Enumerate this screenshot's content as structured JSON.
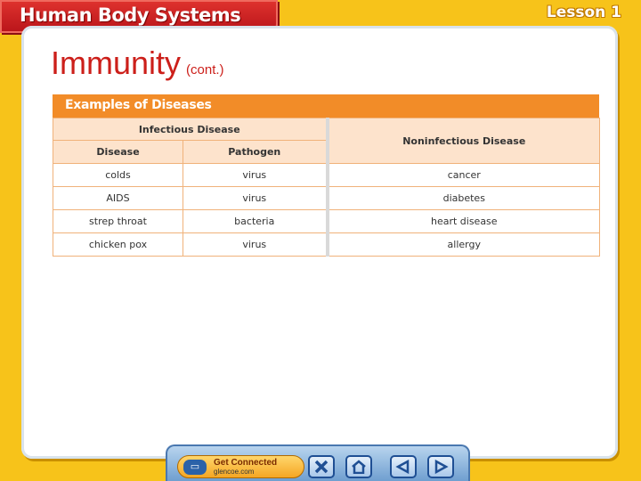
{
  "header": {
    "title": "Human Body Systems",
    "lesson": "Lesson 1"
  },
  "slide": {
    "title": "Immunity",
    "title_suffix": "(cont.)"
  },
  "table": {
    "caption": "Examples of Diseases",
    "group_infectious": "Infectious Disease",
    "group_noninfectious": "Noninfectious Disease",
    "col_disease": "Disease",
    "col_pathogen": "Pathogen",
    "rows": [
      {
        "disease": "colds",
        "pathogen": "virus",
        "noninfectious": "cancer"
      },
      {
        "disease": "AIDS",
        "pathogen": "virus",
        "noninfectious": "diabetes"
      },
      {
        "disease": "strep throat",
        "pathogen": "bacteria",
        "noninfectious": "heart disease"
      },
      {
        "disease": "chicken pox",
        "pathogen": "virus",
        "noninfectious": "allergy"
      }
    ]
  },
  "nav": {
    "get_connected": "Get Connected",
    "site": "glencoe.com",
    "icons": [
      "computer-icon",
      "close-icon",
      "home-icon",
      "back-icon",
      "forward-icon"
    ]
  },
  "colors": {
    "accent": "#f28c28",
    "title": "#cc1f1a",
    "frame": "#f7c31a"
  }
}
